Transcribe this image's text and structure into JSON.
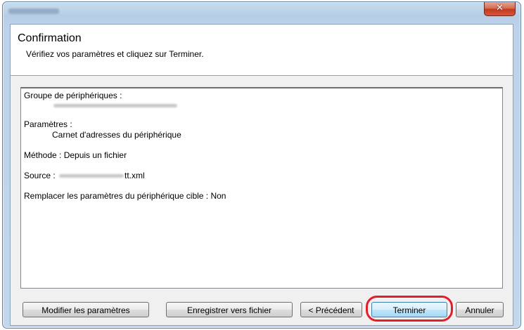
{
  "window": {
    "close_symbol": "✕",
    "title_redacted": true
  },
  "header": {
    "title": "Confirmation",
    "subtitle": "Vérifiez vos paramètres et cliquez sur Terminer."
  },
  "summary": {
    "group_label": "Groupe de périphériques :",
    "params_label": "Paramètres :",
    "params_value": "Carnet d'adresses du périphérique",
    "method_line": "Méthode : Depuis un fichier",
    "source_label": "Source :",
    "source_suffix": "tt.xml",
    "replace_line": "Remplacer les paramètres du périphérique cible : Non"
  },
  "buttons": {
    "modify": "Modifier les paramètres",
    "save_file": "Enregistrer vers fichier",
    "previous": "< Précédent",
    "finish": "Terminer",
    "cancel": "Annuler"
  },
  "highlight": {
    "target": "Terminer",
    "color": "#e31e2b"
  }
}
